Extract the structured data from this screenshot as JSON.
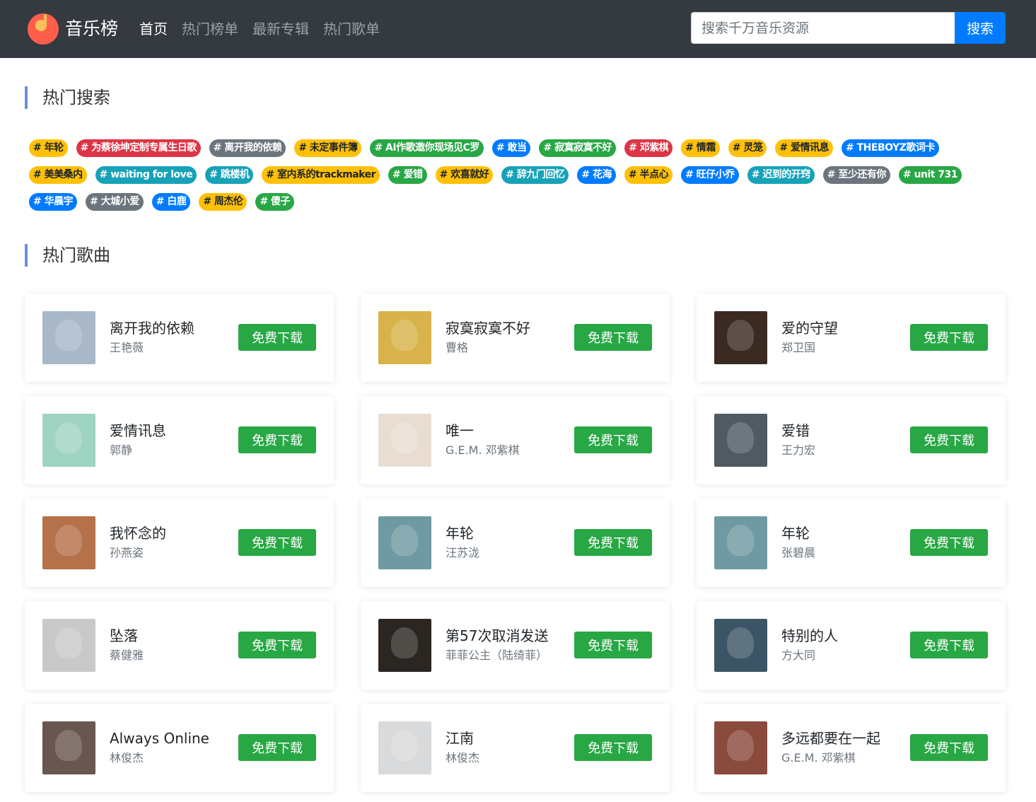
{
  "header": {
    "logo_text": "音乐榜",
    "nav": [
      "首页",
      "热门榜单",
      "最新专辑",
      "热门歌单"
    ],
    "search_placeholder": "搜索千万音乐资源",
    "search_button": "搜索"
  },
  "hot_search": {
    "title": "热门搜索",
    "tags": [
      {
        "text": "# 年轮",
        "style": "warning"
      },
      {
        "text": "# 为蔡徐坤定制专属生日歌",
        "style": "danger"
      },
      {
        "text": "# 离开我的依赖",
        "style": "secondary"
      },
      {
        "text": "# 未定事件簿",
        "style": "warning"
      },
      {
        "text": "# AI作歌邀你现场见C罗",
        "style": "success"
      },
      {
        "text": "# 敢当",
        "style": "primary"
      },
      {
        "text": "# 寂寞寂寞不好",
        "style": "success"
      },
      {
        "text": "# 邓紫棋",
        "style": "danger"
      },
      {
        "text": "# 情霜",
        "style": "warning"
      },
      {
        "text": "# 灵笼",
        "style": "warning"
      },
      {
        "text": "# 爱情讯息",
        "style": "warning"
      },
      {
        "text": "# THEBOYZ歌词卡",
        "style": "primary"
      },
      {
        "text": "# 美美桑内",
        "style": "warning"
      },
      {
        "text": "# waiting for love",
        "style": "info"
      },
      {
        "text": "# 跳楼机",
        "style": "info"
      },
      {
        "text": "# 室内系的trackmaker",
        "style": "warning"
      },
      {
        "text": "# 爱错",
        "style": "success"
      },
      {
        "text": "# 欢喜就好",
        "style": "warning"
      },
      {
        "text": "# 辞九门回忆",
        "style": "info"
      },
      {
        "text": "# 花海",
        "style": "primary"
      },
      {
        "text": "# 半点心",
        "style": "warning"
      },
      {
        "text": "# 旺仔小乔",
        "style": "primary"
      },
      {
        "text": "# 迟到的开窍",
        "style": "info"
      },
      {
        "text": "# 至少还有你",
        "style": "secondary"
      },
      {
        "text": "# unit 731",
        "style": "success"
      },
      {
        "text": "# 华晨宇",
        "style": "primary"
      },
      {
        "text": "# 大城小爱",
        "style": "secondary"
      },
      {
        "text": "# 白鹿",
        "style": "primary"
      },
      {
        "text": "# 周杰伦",
        "style": "warning"
      },
      {
        "text": "# 傻子",
        "style": "success"
      }
    ]
  },
  "hot_songs": {
    "title": "热门歌曲",
    "download_label": "免费下载",
    "songs": [
      {
        "name": "离开我的依赖",
        "artist": "王艳薇",
        "cover_color": "#a9b8c8"
      },
      {
        "name": "寂寞寂寞不好",
        "artist": "曹格",
        "cover_color": "#d8b24a"
      },
      {
        "name": "爱的守望",
        "artist": "郑卫国",
        "cover_color": "#3a2a22"
      },
      {
        "name": "爱情讯息",
        "artist": "郭静",
        "cover_color": "#9fd3c2"
      },
      {
        "name": "唯一",
        "artist": "G.E.M. 邓紫棋",
        "cover_color": "#e9ddd2"
      },
      {
        "name": "爱错",
        "artist": "王力宏",
        "cover_color": "#4f5a63"
      },
      {
        "name": "我怀念的",
        "artist": "孙燕姿",
        "cover_color": "#b5714a"
      },
      {
        "name": "年轮",
        "artist": "汪苏泷",
        "cover_color": "#6f9aa3"
      },
      {
        "name": "年轮",
        "artist": "张碧晨",
        "cover_color": "#6f9aa3"
      },
      {
        "name": "坠落",
        "artist": "蔡健雅",
        "cover_color": "#c9c9c9"
      },
      {
        "name": "第57次取消发送",
        "artist": "菲菲公主（陆绮菲）",
        "cover_color": "#2b2622"
      },
      {
        "name": "特别的人",
        "artist": "方大同",
        "cover_color": "#3c5566"
      },
      {
        "name": "Always Online",
        "artist": "林俊杰",
        "cover_color": "#6a5650"
      },
      {
        "name": "江南",
        "artist": "林俊杰",
        "cover_color": "#d9dadb"
      },
      {
        "name": "多远都要在一起",
        "artist": "G.E.M. 邓紫棋",
        "cover_color": "#8a4a3c"
      }
    ]
  }
}
